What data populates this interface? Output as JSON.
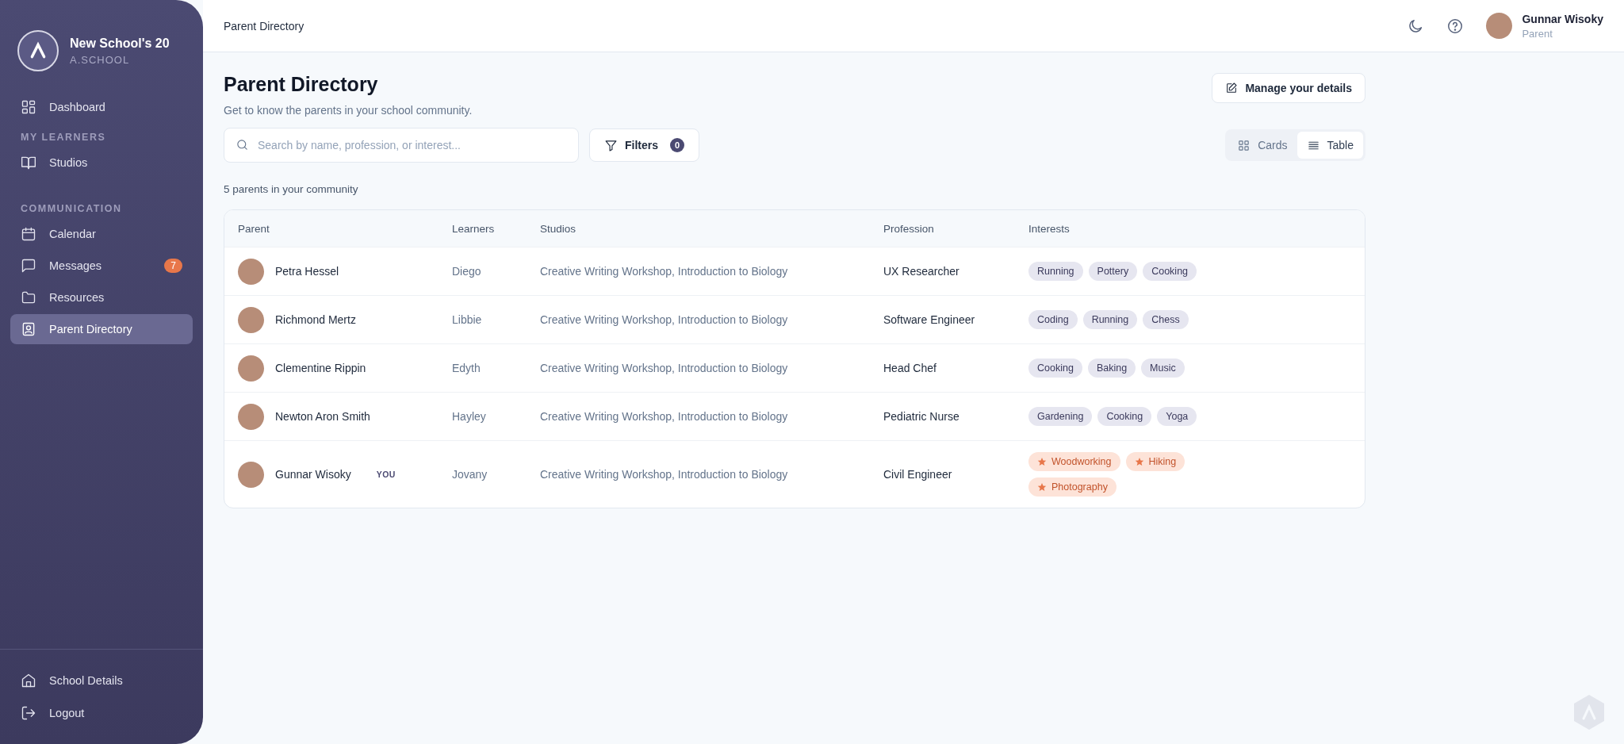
{
  "sidebar": {
    "school_name": "New School's 20",
    "school_subtitle": "A.SCHOOL",
    "nav": [
      {
        "kind": "link",
        "label": "Dashboard",
        "selected": false
      },
      {
        "kind": "heading",
        "label": "MY LEARNERS"
      },
      {
        "kind": "link",
        "label": "Studios",
        "selected": false
      },
      {
        "kind": "heading",
        "label": "COMMUNICATION"
      },
      {
        "kind": "link",
        "label": "Calendar",
        "selected": false
      },
      {
        "kind": "link",
        "label": "Messages",
        "selected": false,
        "badge": "7"
      },
      {
        "kind": "link",
        "label": "Resources",
        "selected": false
      },
      {
        "kind": "link",
        "label": "Parent Directory",
        "selected": true
      }
    ],
    "footer": [
      {
        "label": "School Details"
      },
      {
        "label": "Logout"
      }
    ]
  },
  "header": {
    "breadcrumb": "Parent Directory",
    "user_name": "Gunnar Wisoky",
    "user_role": "Parent"
  },
  "page": {
    "title": "Parent Directory",
    "subtitle": "Get to know the parents in your school community.",
    "manage_button": "Manage your details",
    "search": {
      "placeholder": "Search by name, profession, or interest..."
    },
    "filters": {
      "label": "Filters",
      "count": "0"
    },
    "views": [
      {
        "label": "Cards",
        "selected": false
      },
      {
        "label": "Table",
        "selected": true
      }
    ],
    "count_text": "5 parents in your community"
  },
  "table": {
    "columns": [
      "Parent",
      "Learners",
      "Studios",
      "Profession",
      "Interests"
    ],
    "rows": [
      {
        "name": "Petra Hessel",
        "learners": "Diego",
        "studios": "Creative Writing Workshop, Introduction to Biology",
        "profession": "UX Researcher",
        "interests": [
          {
            "label": "Running",
            "highlighted": false
          },
          {
            "label": "Pottery",
            "highlighted": false
          },
          {
            "label": "Cooking",
            "highlighted": false
          }
        ]
      },
      {
        "name": "Richmond Mertz",
        "learners": "Libbie",
        "studios": "Creative Writing Workshop, Introduction to Biology",
        "profession": "Software Engineer",
        "interests": [
          {
            "label": "Coding",
            "highlighted": false
          },
          {
            "label": "Running",
            "highlighted": false
          },
          {
            "label": "Chess",
            "highlighted": false
          }
        ]
      },
      {
        "name": "Clementine Rippin",
        "learners": "Edyth",
        "studios": "Creative Writing Workshop, Introduction to Biology",
        "profession": "Head Chef",
        "interests": [
          {
            "label": "Cooking",
            "highlighted": false
          },
          {
            "label": "Baking",
            "highlighted": false
          },
          {
            "label": "Music",
            "highlighted": false
          }
        ]
      },
      {
        "name": "Newton Aron Smith",
        "learners": "Hayley",
        "studios": "Creative Writing Workshop, Introduction to Biology",
        "profession": "Pediatric Nurse",
        "interests": [
          {
            "label": "Gardening",
            "highlighted": false
          },
          {
            "label": "Cooking",
            "highlighted": false
          },
          {
            "label": "Yoga",
            "highlighted": false
          }
        ]
      },
      {
        "name": "Gunnar Wisoky",
        "you_badge": "YOU",
        "learners": "Jovany",
        "studios": "Creative Writing Workshop, Introduction to Biology",
        "profession": "Civil Engineer",
        "interests": [
          {
            "label": "Woodworking",
            "highlighted": true
          },
          {
            "label": "Hiking",
            "highlighted": true
          },
          {
            "label": "Photography",
            "highlighted": true
          }
        ]
      }
    ]
  }
}
